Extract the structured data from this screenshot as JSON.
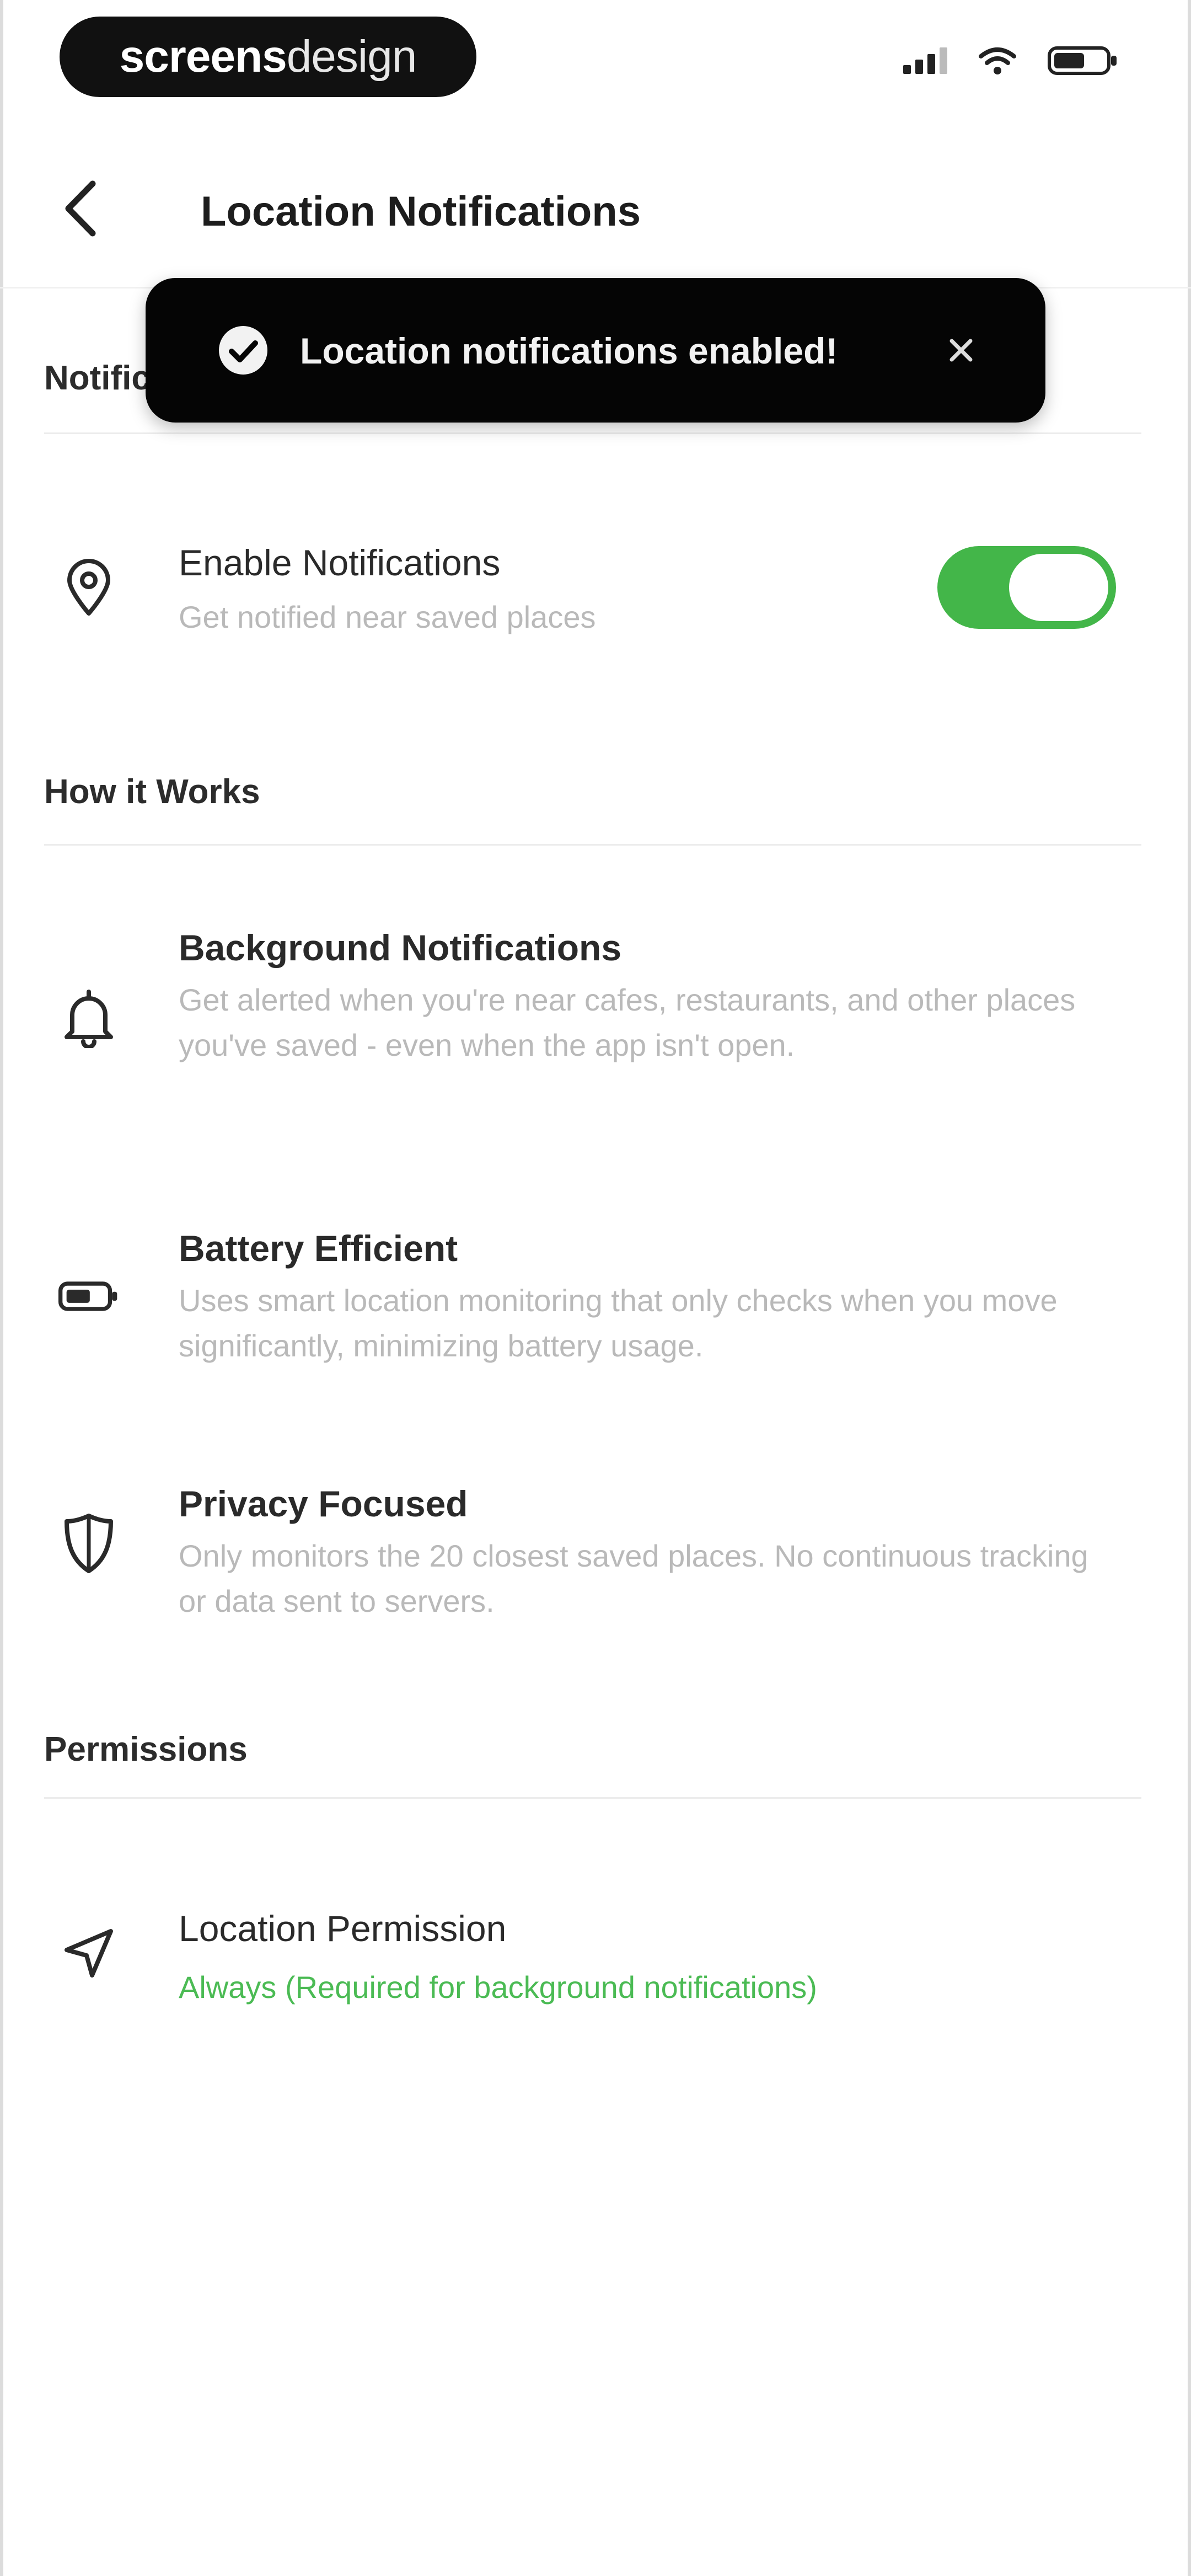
{
  "status_bar": {
    "brand_bold": "screens",
    "brand_light": "design",
    "icons": [
      "signal-icon",
      "wifi-icon",
      "battery-icon"
    ]
  },
  "header": {
    "title": "Location Notifications",
    "back_icon": "chevron-left-icon"
  },
  "toast": {
    "message": "Location notifications enabled!",
    "icon": "check-circle-icon",
    "close_icon": "close-icon"
  },
  "sections": {
    "notifications": {
      "title": "Notifications",
      "enable_row": {
        "title": "Enable Notifications",
        "subtitle": "Get notified near saved places",
        "icon": "location-pin-icon",
        "toggle_on": true
      }
    },
    "how_it_works": {
      "title": "How it Works",
      "items": [
        {
          "title": "Background Notifications",
          "description": "Get alerted when you're near cafes, restaurants, and other places you've saved - even when the app isn't open.",
          "icon": "bell-icon"
        },
        {
          "title": "Battery Efficient",
          "description": "Uses smart location monitoring that only checks when you move significantly, minimizing battery usage.",
          "icon": "battery-icon"
        },
        {
          "title": "Privacy Focused",
          "description": "Only monitors the 20 closest saved places. No continuous tracking or data sent to servers.",
          "icon": "shield-icon"
        }
      ]
    },
    "permissions": {
      "title": "Permissions",
      "location_row": {
        "title": "Location Permission",
        "status": "Always (Required for background notifications)",
        "icon": "navigation-arrow-icon"
      }
    }
  },
  "colors": {
    "accent_green": "#43b649",
    "toast_bg": "#050505",
    "muted_text": "#b9b9b9"
  }
}
